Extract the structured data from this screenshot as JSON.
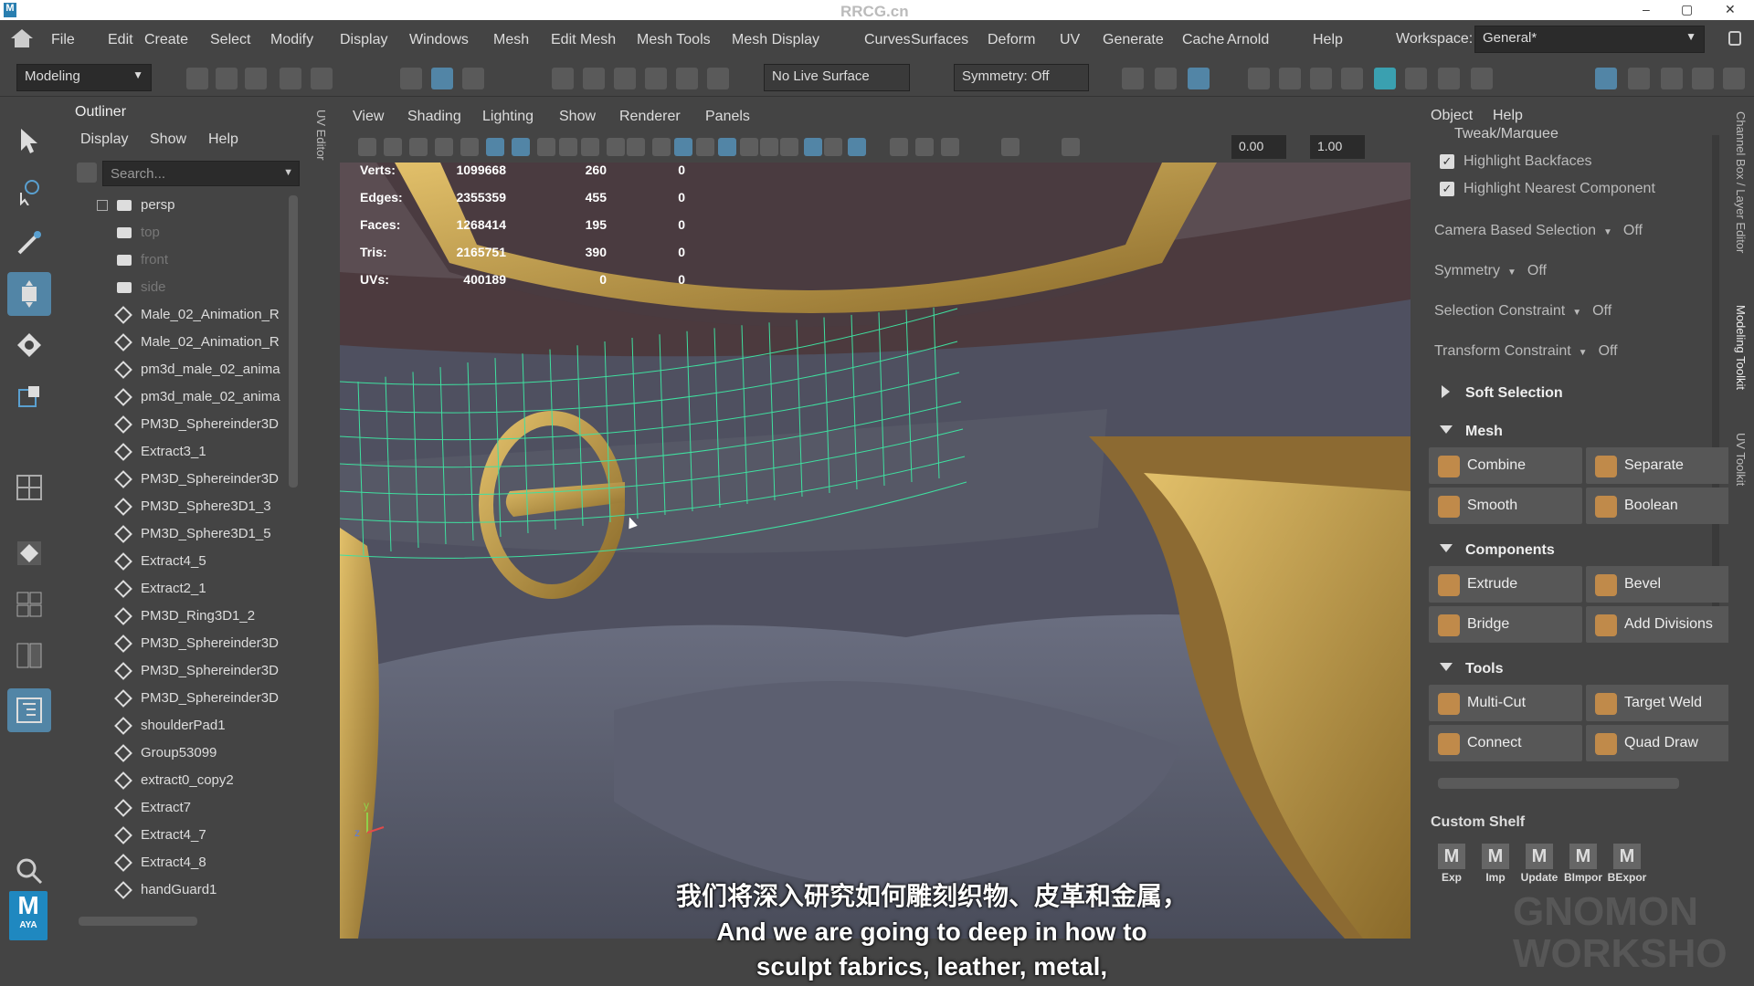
{
  "titlebar": {
    "watermark": "RRCG.cn",
    "min": "–",
    "max": "▢",
    "close": "✕"
  },
  "menubar": {
    "items": [
      "File",
      "Edit",
      "Create",
      "Select",
      "Modify",
      "Display",
      "Windows",
      "Mesh",
      "Edit Mesh",
      "Mesh Tools",
      "Mesh Display",
      "Curves",
      "Surfaces",
      "Deform",
      "UV",
      "Generate",
      "Cache",
      "Arnold",
      "Help"
    ],
    "workspace_label": "Workspace:",
    "workspace_value": "General*"
  },
  "statusline": {
    "mode": "Modeling",
    "live_surface": "No Live Surface",
    "symmetry": "Symmetry: Off"
  },
  "outliner": {
    "title": "Outliner",
    "menu": [
      "Display",
      "Show",
      "Help"
    ],
    "search_placeholder": "Search...",
    "items": [
      {
        "label": "persp",
        "type": "camera",
        "dim": false
      },
      {
        "label": "top",
        "type": "camera",
        "dim": true
      },
      {
        "label": "front",
        "type": "camera",
        "dim": true
      },
      {
        "label": "side",
        "type": "camera",
        "dim": true
      },
      {
        "label": "Male_02_Animation_R",
        "type": "mesh",
        "dim": false
      },
      {
        "label": "Male_02_Animation_R",
        "type": "mesh",
        "dim": false
      },
      {
        "label": "pm3d_male_02_anima",
        "type": "mesh",
        "dim": false
      },
      {
        "label": "pm3d_male_02_anima",
        "type": "mesh",
        "dim": false
      },
      {
        "label": "PM3D_Sphereinder3D",
        "type": "mesh",
        "dim": false
      },
      {
        "label": "Extract3_1",
        "type": "mesh",
        "dim": false
      },
      {
        "label": "PM3D_Sphereinder3D",
        "type": "mesh",
        "dim": false
      },
      {
        "label": "PM3D_Sphere3D1_3",
        "type": "mesh",
        "dim": false
      },
      {
        "label": "PM3D_Sphere3D1_5",
        "type": "mesh",
        "dim": false
      },
      {
        "label": "Extract4_5",
        "type": "mesh",
        "dim": false
      },
      {
        "label": "Extract2_1",
        "type": "mesh",
        "dim": false
      },
      {
        "label": "PM3D_Ring3D1_2",
        "type": "mesh",
        "dim": false
      },
      {
        "label": "PM3D_Sphereinder3D",
        "type": "mesh",
        "dim": false
      },
      {
        "label": "PM3D_Sphereinder3D",
        "type": "mesh",
        "dim": false
      },
      {
        "label": "PM3D_Sphereinder3D",
        "type": "mesh",
        "dim": false
      },
      {
        "label": "shoulderPad1",
        "type": "mesh",
        "dim": false
      },
      {
        "label": "Group53099",
        "type": "mesh",
        "dim": false
      },
      {
        "label": "extract0_copy2",
        "type": "mesh",
        "dim": false
      },
      {
        "label": "Extract7",
        "type": "mesh",
        "dim": false
      },
      {
        "label": "Extract4_7",
        "type": "mesh",
        "dim": false
      },
      {
        "label": "Extract4_8",
        "type": "mesh",
        "dim": false
      },
      {
        "label": "handGuard1",
        "type": "mesh",
        "dim": false
      }
    ]
  },
  "uv_editor_tab": "UV Editor",
  "viewport": {
    "menu": [
      "View",
      "Shading",
      "Lighting",
      "Show",
      "Renderer",
      "Panels"
    ],
    "field1": "0.00",
    "field2": "1.00",
    "hud": [
      {
        "label": "Verts:",
        "total": "1099668",
        "selected": "260",
        "third": "0"
      },
      {
        "label": "Edges:",
        "total": "2355359",
        "selected": "455",
        "third": "0"
      },
      {
        "label": "Faces:",
        "total": "1268414",
        "selected": "195",
        "third": "0"
      },
      {
        "label": "Tris:",
        "total": "2165751",
        "selected": "390",
        "third": "0"
      },
      {
        "label": "UVs:",
        "total": "400189",
        "selected": "0",
        "third": "0"
      }
    ],
    "axis_y": "y",
    "axis_z": "z"
  },
  "rightpanel": {
    "tabs": [
      "Object",
      "Help"
    ],
    "tweak": "Tweak/Marquee",
    "checks": [
      {
        "label": "Highlight Backfaces"
      },
      {
        "label": "Highlight Nearest Component"
      }
    ],
    "options": [
      {
        "label": "Camera Based Selection",
        "value": "Off"
      },
      {
        "label": "Symmetry",
        "value": "Off"
      },
      {
        "label": "Selection Constraint",
        "value": "Off"
      },
      {
        "label": "Transform Constraint",
        "value": "Off"
      }
    ],
    "soft_selection": "Soft Selection",
    "sections": [
      {
        "title": "Mesh",
        "buttons": [
          "Combine",
          "Separate",
          "Smooth",
          "Boolean"
        ]
      },
      {
        "title": "Components",
        "buttons": [
          "Extrude",
          "Bevel",
          "Bridge",
          "Add Divisions"
        ]
      },
      {
        "title": "Tools",
        "buttons": [
          "Multi-Cut",
          "Target Weld",
          "Connect",
          "Quad Draw"
        ]
      }
    ],
    "custom_shelf": "Custom Shelf",
    "shelf_items": [
      "Exp",
      "Imp",
      "Update",
      "BImpor",
      "BExpor"
    ]
  },
  "side_tabs": [
    "Channel Box / Layer Editor",
    "Modeling Toolkit",
    "UV Toolkit"
  ],
  "logo": {
    "letter": "M",
    "sub": "AYA"
  },
  "subtitles": {
    "cn": "我们将深入研究如何雕刻织物、皮革和金属，",
    "en1": "And we are going to deep in how to",
    "en2": "sculpt fabrics, leather, metal,"
  },
  "watermark_br": "GNOMON WORKSHOP",
  "colors": {
    "accent": "#5285a6",
    "gold": "#c9a24a",
    "wire": "#3fe0a0"
  }
}
